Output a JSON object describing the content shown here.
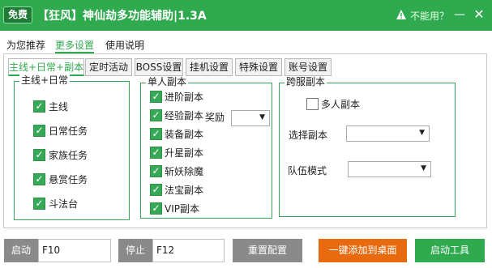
{
  "titlebar": {
    "badge": "免费",
    "title": "【狂风】神仙劫多功能辅助|1.3A",
    "help": "不能用？",
    "minimize": "—",
    "close": "✕"
  },
  "outer_tabs": [
    "为您推荐",
    "更多设置",
    "使用说明"
  ],
  "inner_tabs": [
    "主线+日常+副本",
    "定时活动",
    "BOSS设置",
    "挂机设置",
    "特殊设置",
    "账号设置"
  ],
  "group_main": {
    "title": "主线+日常",
    "items": [
      "主线",
      "日常任务",
      "家族任务",
      "悬赏任务",
      "斗法台"
    ]
  },
  "group_dungeon": {
    "title": "单人副本",
    "items": [
      "进阶副本",
      "经验副本",
      "装备副本",
      "升星副本",
      "斩妖除魔",
      "法宝副本",
      "VIP副本"
    ],
    "reward_label": "奖励",
    "reward_value": ""
  },
  "group_cross": {
    "title": "跨服副本",
    "multi_label": "多人副本",
    "select_dungeon_label": "选择副本",
    "select_dungeon_value": "",
    "team_mode_label": "队伍模式",
    "team_mode_value": ""
  },
  "bottom": {
    "start_label": "启动",
    "start_hotkey": "F10",
    "stop_label": "停止",
    "stop_hotkey": "F12",
    "reset_label": "重置配置",
    "add_desktop_label": "一键添加到桌面",
    "launch_tool_label": "启动工具"
  }
}
